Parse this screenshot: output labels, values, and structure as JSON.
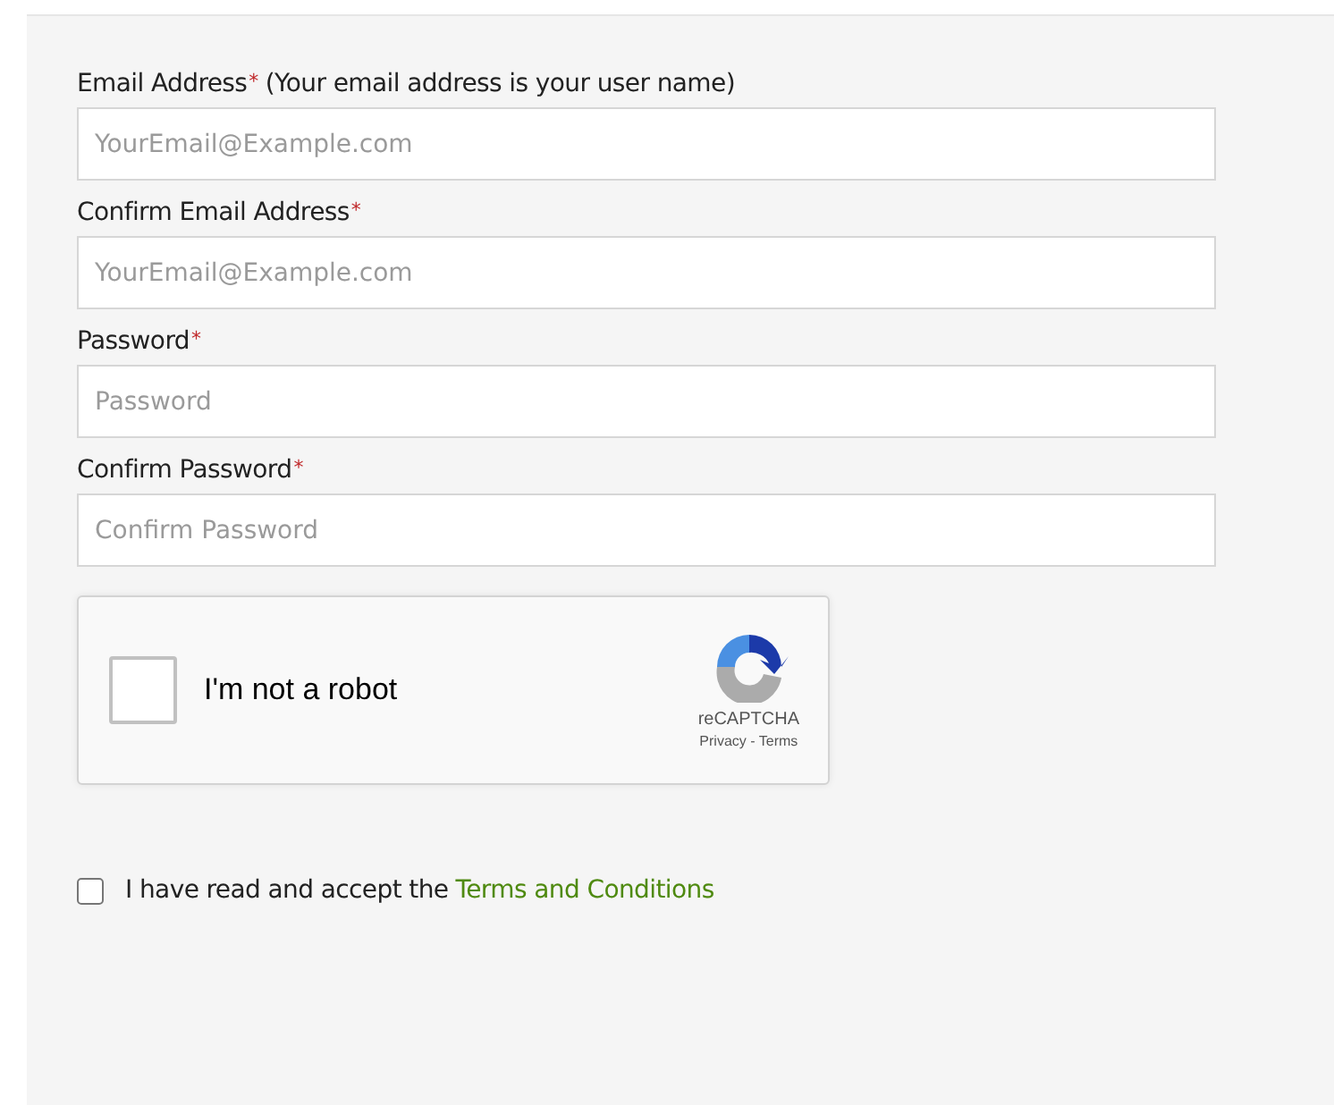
{
  "fields": [
    {
      "label": "Email Address",
      "required_mark": "*",
      "note": "(Your email address is your user name)",
      "placeholder": "YourEmail@Example.com"
    },
    {
      "label": "Confirm Email Address",
      "required_mark": "*",
      "placeholder": "YourEmail@Example.com"
    },
    {
      "label": "Password",
      "required_mark": "*",
      "placeholder": "Password"
    },
    {
      "label": "Confirm Password",
      "required_mark": "*",
      "placeholder": "Confirm Password"
    }
  ],
  "captcha": {
    "label": "I'm not a robot",
    "checked": false,
    "brand": "reCAPTCHA",
    "links": "Privacy - Terms"
  },
  "terms": {
    "checked": false,
    "text": "I have read and accept the",
    "link": "Terms and Conditions"
  }
}
